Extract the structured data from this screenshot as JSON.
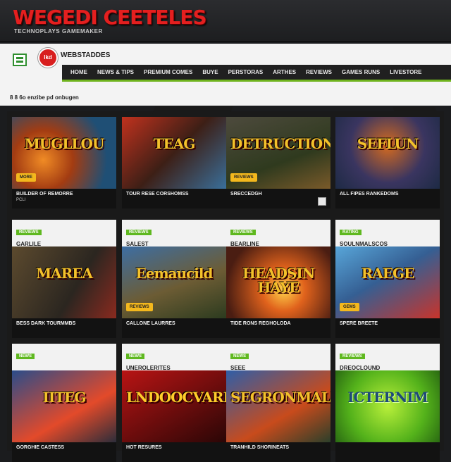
{
  "header": {
    "brand": "WEGEDI CEETELES",
    "tagline": "TECHNOPLAYS GAMEMAKER"
  },
  "topnav": {
    "logo_text": "lkd",
    "site_name": "WEBSTADDES",
    "items": [
      "HOME",
      "NEWS & TIPS",
      "PREMIUM COMES",
      "BUYE",
      "PERSTORAS",
      "ARTHES",
      "REVIEWS",
      "GAMES RUNS",
      "LIVESTORE"
    ]
  },
  "breadcrumb": {
    "prefix": "8 8 6o",
    "text": "enzibe pd onbugen"
  },
  "cards": [
    {
      "tag": "",
      "sub": "",
      "art": "MUGLLOU",
      "badge": "MORE",
      "title": "BUILDER OF REMORRE",
      "subline": "PCLI",
      "corner": false
    },
    {
      "tag": "",
      "sub": "",
      "art": "TEAG",
      "badge": "",
      "title": "TOUR RESE CORSHOMSS",
      "subline": "",
      "corner": false
    },
    {
      "tag": "",
      "sub": "",
      "art": "DETRUCTION",
      "badge": "REVIEWS",
      "title": "SRECCEDGH",
      "subline": "",
      "corner": true
    },
    {
      "tag": "",
      "sub": "",
      "art": "SEFLUN",
      "badge": "",
      "title": "ALL FIPES RANKEDOMS",
      "subline": "",
      "corner": false
    },
    {
      "tag": "REVIEWS",
      "sub": "GARLILE",
      "art": "MAREA",
      "badge": "",
      "title": "BESS DARK TOURMMBS",
      "subline": "",
      "corner": false
    },
    {
      "tag": "REVIEWS",
      "sub": "SALEST",
      "art": "Eemaucild",
      "badge": "REVIEWS",
      "title": "CALLONE LAURRES",
      "subline": "",
      "corner": false
    },
    {
      "tag": "REVIEWS",
      "sub": "BEARLINE",
      "art": "HEADSIN HAYE",
      "badge": "",
      "title": "TIDE RONS REGHOLODA",
      "subline": "",
      "corner": false
    },
    {
      "tag": "RATING",
      "sub": "SOULNMALSCOS",
      "art": "RAEGE",
      "badge": "GEMS",
      "title": "SPERE BREETE",
      "subline": "",
      "corner": false
    },
    {
      "tag": "NEWS",
      "sub": "",
      "art": "IITEG",
      "badge": "",
      "title": "GORGHIE CASTESS",
      "subline": "",
      "corner": false
    },
    {
      "tag": "NEWS",
      "sub": "UNEROLERITES",
      "art": "LNDOOCVARBEE",
      "badge": "",
      "title": "HOT RESURES",
      "subline": "",
      "corner": false
    },
    {
      "tag": "NEWS",
      "sub": "SEEE",
      "art": "SEGRONMALE",
      "badge": "",
      "title": "TRANHILD SHORINEATS",
      "subline": "",
      "corner": false
    },
    {
      "tag": "REVIEWS",
      "sub": "DREOCLOUND",
      "art": "ICTERNIM",
      "badge": "",
      "title": "",
      "subline": "",
      "corner": false
    }
  ]
}
